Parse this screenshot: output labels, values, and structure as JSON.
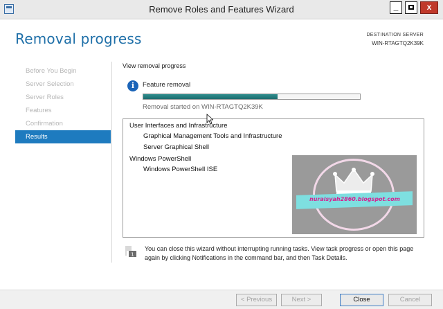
{
  "window": {
    "title": "Remove Roles and Features Wizard",
    "icon": "server-manager-icon",
    "controls": {
      "minimize": "_",
      "close": "x"
    }
  },
  "header": {
    "title": "Removal progress",
    "destination_label": "DESTINATION SERVER",
    "destination_value": "WIN-RTAGTQ2K39K"
  },
  "sidebar": {
    "items": [
      {
        "label": "Before You Begin",
        "state": "disabled"
      },
      {
        "label": "Server Selection",
        "state": "disabled"
      },
      {
        "label": "Server Roles",
        "state": "disabled"
      },
      {
        "label": "Features",
        "state": "disabled"
      },
      {
        "label": "Confirmation",
        "state": "disabled"
      },
      {
        "label": "Results",
        "state": "active"
      }
    ]
  },
  "main": {
    "section_label": "View removal progress",
    "progress": {
      "icon": "info-icon",
      "title": "Feature removal",
      "fraction": 0.62,
      "status": "Removal started on WIN-RTAGTQ2K39K"
    },
    "results": {
      "groups": [
        {
          "title": "User Interfaces and Infrastructure",
          "items": [
            "Graphical Management Tools and Infrastructure",
            "Server Graphical Shell"
          ]
        },
        {
          "title": "Windows PowerShell",
          "items": [
            "Windows PowerShell ISE"
          ]
        }
      ]
    },
    "watermark_text": "nuraisyah2860.blogspot.com",
    "note": {
      "icon": "flag-note-icon",
      "text": "You can close this wizard without interrupting running tasks. View task progress or open this page again by clicking Notifications in the command bar, and then Task Details."
    }
  },
  "footer": {
    "previous_label": "< Previous",
    "next_label": "Next >",
    "close_label": "Close",
    "cancel_label": "Cancel"
  },
  "colors": {
    "accent": "#1e7bbf",
    "title_blue": "#1e6fa8",
    "progress_fill": "#1d6c6e",
    "disabled_text": "#b7b7b7"
  }
}
